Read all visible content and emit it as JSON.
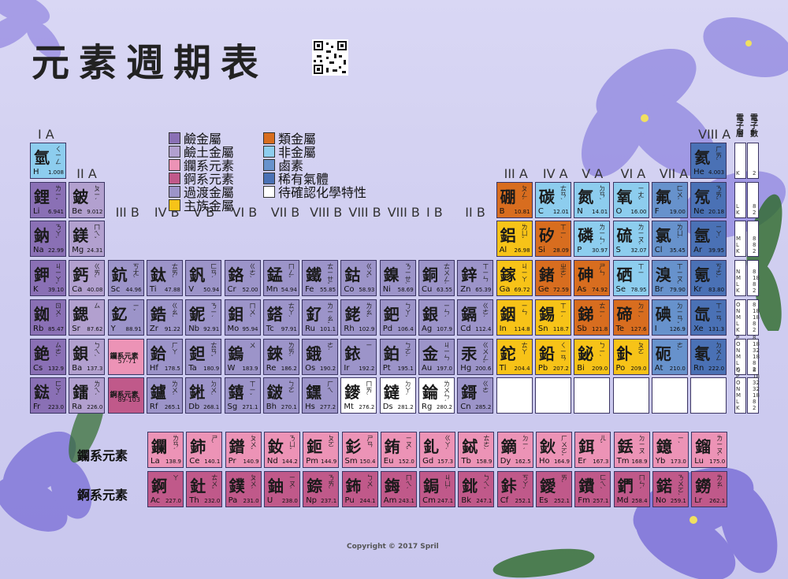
{
  "title": "元素週期表",
  "colors": {
    "alkali": "#8a70b5",
    "alkaline_earth": "#b2a0cf",
    "lanthanide": "#ec93b6",
    "actinide": "#c0598a",
    "transition": "#9c94c9",
    "main_metal": "#f7c318",
    "metalloid": "#d86d1f",
    "nonmetal": "#8dcdee",
    "halogen": "#6792cc",
    "noble_gas": "#4a71b5",
    "unknown": "#ffffff"
  },
  "legend": [
    {
      "label": "鹼金屬",
      "type": "alkali"
    },
    {
      "label": "鹼土金屬",
      "type": "alkaline_earth"
    },
    {
      "label": "鑭系元素",
      "type": "lanthanide"
    },
    {
      "label": "錒系元素",
      "type": "actinide"
    },
    {
      "label": "過渡金屬",
      "type": "transition"
    },
    {
      "label": "主族金屬",
      "type": "main_metal"
    },
    {
      "label": "類金屬",
      "type": "metalloid"
    },
    {
      "label": "非金屬",
      "type": "nonmetal"
    },
    {
      "label": "鹵素",
      "type": "halogen"
    },
    {
      "label": "稀有氣體",
      "type": "noble_gas"
    },
    {
      "label": "待確認化學特性",
      "type": "unknown"
    }
  ],
  "group_labels": [
    "I A",
    "II A",
    "III B",
    "IV B",
    "V B",
    "VI B",
    "VII B",
    "VIII B",
    "VIII B",
    "VIII B",
    "I B",
    "II B",
    "III A",
    "IV A",
    "V A",
    "VI A",
    "VII A",
    "VIII A"
  ],
  "shell_headers": {
    "shell": "電子層",
    "electrons": "電子數"
  },
  "shells": [
    {
      "k": "K",
      "e": "2"
    },
    {
      "k": "L K",
      "e": "8 2"
    },
    {
      "k": "M L K",
      "e": "8 8 2"
    },
    {
      "k": "N M L K",
      "e": "8 18 8 2"
    },
    {
      "k": "O N M L K",
      "e": "8 18 18 8 2"
    },
    {
      "k": "P O N M L K",
      "e": "8 18 32 18 8 2"
    },
    {
      "k": "Q P O N M L K",
      "e": "8 18 32 32 18 8 2"
    }
  ],
  "elements": [
    {
      "ch": "氫",
      "zy": "ㄑㄧㄥ",
      "sym": "H",
      "mass": "1.008",
      "r": 1,
      "c": 1,
      "t": "nonmetal"
    },
    {
      "ch": "氦",
      "zy": "ㄏㄞˋ",
      "sym": "He",
      "mass": "4.003",
      "r": 1,
      "c": 18,
      "t": "noble_gas"
    },
    {
      "ch": "鋰",
      "zy": "ㄌㄧˇ",
      "sym": "Li",
      "mass": "6.941",
      "r": 2,
      "c": 1,
      "t": "alkali"
    },
    {
      "ch": "鈹",
      "zy": "ㄆㄧˊ",
      "sym": "Be",
      "mass": "9.012",
      "r": 2,
      "c": 2,
      "t": "alkaline_earth"
    },
    {
      "ch": "硼",
      "zy": "ㄆㄥˊ",
      "sym": "B",
      "mass": "10.81",
      "r": 2,
      "c": 13,
      "t": "metalloid"
    },
    {
      "ch": "碳",
      "zy": "ㄊㄢˋ",
      "sym": "C",
      "mass": "12.01",
      "r": 2,
      "c": 14,
      "t": "nonmetal"
    },
    {
      "ch": "氮",
      "zy": "ㄉㄢˋ",
      "sym": "N",
      "mass": "14.01",
      "r": 2,
      "c": 15,
      "t": "nonmetal"
    },
    {
      "ch": "氧",
      "zy": "ㄧㄤˇ",
      "sym": "O",
      "mass": "16.00",
      "r": 2,
      "c": 16,
      "t": "nonmetal"
    },
    {
      "ch": "氟",
      "zy": "ㄈㄨˊ",
      "sym": "F",
      "mass": "19.00",
      "r": 2,
      "c": 17,
      "t": "halogen"
    },
    {
      "ch": "氖",
      "zy": "ㄋㄞˇ",
      "sym": "Ne",
      "mass": "20.18",
      "r": 2,
      "c": 18,
      "t": "noble_gas"
    },
    {
      "ch": "鈉",
      "zy": "ㄋㄚˋ",
      "sym": "Na",
      "mass": "22.99",
      "r": 3,
      "c": 1,
      "t": "alkali"
    },
    {
      "ch": "鎂",
      "zy": "ㄇㄟˇ",
      "sym": "Mg",
      "mass": "24.31",
      "r": 3,
      "c": 2,
      "t": "alkaline_earth"
    },
    {
      "ch": "鋁",
      "zy": "ㄌㄩˇ",
      "sym": "Al",
      "mass": "26.98",
      "r": 3,
      "c": 13,
      "t": "main_metal"
    },
    {
      "ch": "矽",
      "zy": "ㄒㄧˋ",
      "sym": "Si",
      "mass": "28.09",
      "r": 3,
      "c": 14,
      "t": "metalloid"
    },
    {
      "ch": "磷",
      "zy": "ㄌㄧㄣˊ",
      "sym": "P",
      "mass": "30.97",
      "r": 3,
      "c": 15,
      "t": "nonmetal"
    },
    {
      "ch": "硫",
      "zy": "ㄌㄧㄡˊ",
      "sym": "S",
      "mass": "32.07",
      "r": 3,
      "c": 16,
      "t": "nonmetal"
    },
    {
      "ch": "氯",
      "zy": "ㄌㄩˋ",
      "sym": "Cl",
      "mass": "35.45",
      "r": 3,
      "c": 17,
      "t": "halogen"
    },
    {
      "ch": "氬",
      "zy": "ㄧㄚˋ",
      "sym": "Ar",
      "mass": "39.95",
      "r": 3,
      "c": 18,
      "t": "noble_gas"
    },
    {
      "ch": "鉀",
      "zy": "ㄐㄧㄚˇ",
      "sym": "K",
      "mass": "39.10",
      "r": 4,
      "c": 1,
      "t": "alkali"
    },
    {
      "ch": "鈣",
      "zy": "ㄍㄞˋ",
      "sym": "Ca",
      "mass": "40.08",
      "r": 4,
      "c": 2,
      "t": "alkaline_earth"
    },
    {
      "ch": "鈧",
      "zy": "ㄎㄤˋ",
      "sym": "Sc",
      "mass": "44.96",
      "r": 4,
      "c": 3,
      "t": "transition"
    },
    {
      "ch": "鈦",
      "zy": "ㄊㄞˋ",
      "sym": "Ti",
      "mass": "47.88",
      "r": 4,
      "c": 4,
      "t": "transition"
    },
    {
      "ch": "釩",
      "zy": "ㄈㄢˊ",
      "sym": "V",
      "mass": "50.94",
      "r": 4,
      "c": 5,
      "t": "transition"
    },
    {
      "ch": "鉻",
      "zy": "ㄍㄜˋ",
      "sym": "Cr",
      "mass": "52.00",
      "r": 4,
      "c": 6,
      "t": "transition"
    },
    {
      "ch": "錳",
      "zy": "ㄇㄥˇ",
      "sym": "Mn",
      "mass": "54.94",
      "r": 4,
      "c": 7,
      "t": "transition"
    },
    {
      "ch": "鐵",
      "zy": "ㄊㄧㄝˇ",
      "sym": "Fe",
      "mass": "55.85",
      "r": 4,
      "c": 8,
      "t": "transition"
    },
    {
      "ch": "鈷",
      "zy": "ㄍㄨˇ",
      "sym": "Co",
      "mass": "58.93",
      "r": 4,
      "c": 9,
      "t": "transition"
    },
    {
      "ch": "鎳",
      "zy": "ㄋㄧㄝˋ",
      "sym": "Ni",
      "mass": "58.69",
      "r": 4,
      "c": 10,
      "t": "transition"
    },
    {
      "ch": "銅",
      "zy": "ㄊㄨㄥˊ",
      "sym": "Cu",
      "mass": "63.55",
      "r": 4,
      "c": 11,
      "t": "transition"
    },
    {
      "ch": "鋅",
      "zy": "ㄒㄧㄣ",
      "sym": "Zn",
      "mass": "65.39",
      "r": 4,
      "c": 12,
      "t": "transition"
    },
    {
      "ch": "鎵",
      "zy": "ㄐㄧㄚ",
      "sym": "Ga",
      "mass": "69.72",
      "r": 4,
      "c": 13,
      "t": "main_metal"
    },
    {
      "ch": "鍺",
      "zy": "ㄓㄜˇ",
      "sym": "Ge",
      "mass": "72.59",
      "r": 4,
      "c": 14,
      "t": "metalloid"
    },
    {
      "ch": "砷",
      "zy": "ㄕㄣ",
      "sym": "As",
      "mass": "74.92",
      "r": 4,
      "c": 15,
      "t": "metalloid"
    },
    {
      "ch": "硒",
      "zy": "ㄒㄧ",
      "sym": "Se",
      "mass": "78.95",
      "r": 4,
      "c": 16,
      "t": "nonmetal"
    },
    {
      "ch": "溴",
      "zy": "ㄒㄧㄡˋ",
      "sym": "Br",
      "mass": "79.90",
      "r": 4,
      "c": 17,
      "t": "halogen"
    },
    {
      "ch": "氪",
      "zy": "ㄎㄜˋ",
      "sym": "Kr",
      "mass": "83.80",
      "r": 4,
      "c": 18,
      "t": "noble_gas"
    },
    {
      "ch": "銣",
      "zy": "ㄖㄨˊ",
      "sym": "Rb",
      "mass": "85.47",
      "r": 5,
      "c": 1,
      "t": "alkali"
    },
    {
      "ch": "鍶",
      "zy": "ㄙ",
      "sym": "Sr",
      "mass": "87.62",
      "r": 5,
      "c": 2,
      "t": "alkaline_earth"
    },
    {
      "ch": "釔",
      "zy": "ㄧˇ",
      "sym": "Y",
      "mass": "88.91",
      "r": 5,
      "c": 3,
      "t": "transition"
    },
    {
      "ch": "鋯",
      "zy": "ㄍㄠˋ",
      "sym": "Zr",
      "mass": "91.22",
      "r": 5,
      "c": 4,
      "t": "transition"
    },
    {
      "ch": "鈮",
      "zy": "ㄋㄧˊ",
      "sym": "Nb",
      "mass": "92.91",
      "r": 5,
      "c": 5,
      "t": "transition"
    },
    {
      "ch": "鉬",
      "zy": "ㄇㄨˋ",
      "sym": "Mo",
      "mass": "95.94",
      "r": 5,
      "c": 6,
      "t": "transition"
    },
    {
      "ch": "鎝",
      "zy": "ㄊㄚˋ",
      "sym": "Tc",
      "mass": "97.91",
      "r": 5,
      "c": 7,
      "t": "transition"
    },
    {
      "ch": "釕",
      "zy": "ㄌㄧㄠˇ",
      "sym": "Ru",
      "mass": "101.1",
      "r": 5,
      "c": 8,
      "t": "transition"
    },
    {
      "ch": "銠",
      "zy": "ㄌㄠˇ",
      "sym": "Rh",
      "mass": "102.9",
      "r": 5,
      "c": 9,
      "t": "transition"
    },
    {
      "ch": "鈀",
      "zy": "ㄅㄚˇ",
      "sym": "Pd",
      "mass": "106.4",
      "r": 5,
      "c": 10,
      "t": "transition"
    },
    {
      "ch": "銀",
      "zy": "ㄧㄣˊ",
      "sym": "Ag",
      "mass": "107.9",
      "r": 5,
      "c": 11,
      "t": "transition"
    },
    {
      "ch": "鎘",
      "zy": "ㄍㄜˊ",
      "sym": "Cd",
      "mass": "112.4",
      "r": 5,
      "c": 12,
      "t": "transition"
    },
    {
      "ch": "銦",
      "zy": "ㄧㄣ",
      "sym": "In",
      "mass": "114.8",
      "r": 5,
      "c": 13,
      "t": "main_metal"
    },
    {
      "ch": "錫",
      "zy": "ㄒㄧˊ",
      "sym": "Sn",
      "mass": "118.7",
      "r": 5,
      "c": 14,
      "t": "main_metal"
    },
    {
      "ch": "銻",
      "zy": "ㄊㄧˊ",
      "sym": "Sb",
      "mass": "121.8",
      "r": 5,
      "c": 15,
      "t": "metalloid"
    },
    {
      "ch": "碲",
      "zy": "ㄉㄧˋ",
      "sym": "Te",
      "mass": "127.6",
      "r": 5,
      "c": 16,
      "t": "metalloid"
    },
    {
      "ch": "碘",
      "zy": "ㄉㄧㄢˇ",
      "sym": "I",
      "mass": "126.9",
      "r": 5,
      "c": 17,
      "t": "halogen"
    },
    {
      "ch": "氙",
      "zy": "ㄒㄧㄢ",
      "sym": "Xe",
      "mass": "131.3",
      "r": 5,
      "c": 18,
      "t": "noble_gas"
    },
    {
      "ch": "銫",
      "zy": "ㄙㄜˋ",
      "sym": "Cs",
      "mass": "132.9",
      "r": 6,
      "c": 1,
      "t": "alkali"
    },
    {
      "ch": "鋇",
      "zy": "ㄅㄟˋ",
      "sym": "Ba",
      "mass": "137.3",
      "r": 6,
      "c": 2,
      "t": "alkaline_earth"
    },
    {
      "ch": "鑭系元素",
      "zy": "",
      "sym": "57-71",
      "mass": "",
      "r": 6,
      "c": 3,
      "t": "lanthanide",
      "ph": true
    },
    {
      "ch": "鉿",
      "zy": "ㄏㄚ",
      "sym": "Hf",
      "mass": "178.5",
      "r": 6,
      "c": 4,
      "t": "transition"
    },
    {
      "ch": "鉭",
      "zy": "ㄊㄢˇ",
      "sym": "Ta",
      "mass": "180.9",
      "r": 6,
      "c": 5,
      "t": "transition"
    },
    {
      "ch": "鎢",
      "zy": "ㄨ",
      "sym": "W",
      "mass": "183.9",
      "r": 6,
      "c": 6,
      "t": "transition"
    },
    {
      "ch": "錸",
      "zy": "ㄌㄞˊ",
      "sym": "Re",
      "mass": "186.2",
      "r": 6,
      "c": 7,
      "t": "transition"
    },
    {
      "ch": "鋨",
      "zy": "ㄜˊ",
      "sym": "Os",
      "mass": "190.2",
      "r": 6,
      "c": 8,
      "t": "transition"
    },
    {
      "ch": "銥",
      "zy": "ㄧ",
      "sym": "Ir",
      "mass": "192.2",
      "r": 6,
      "c": 9,
      "t": "transition"
    },
    {
      "ch": "鉑",
      "zy": "ㄅㄛˊ",
      "sym": "Pt",
      "mass": "195.1",
      "r": 6,
      "c": 10,
      "t": "transition"
    },
    {
      "ch": "金",
      "zy": "ㄐㄧㄣ",
      "sym": "Au",
      "mass": "197.0",
      "r": 6,
      "c": 11,
      "t": "transition"
    },
    {
      "ch": "汞",
      "zy": "ㄍㄨㄥˇ",
      "sym": "Hg",
      "mass": "200.6",
      "r": 6,
      "c": 12,
      "t": "transition"
    },
    {
      "ch": "鉈",
      "zy": "ㄊㄚ",
      "sym": "Tl",
      "mass": "204.4",
      "r": 6,
      "c": 13,
      "t": "main_metal"
    },
    {
      "ch": "鉛",
      "zy": "ㄑㄧㄢ",
      "sym": "Pb",
      "mass": "207.2",
      "r": 6,
      "c": 14,
      "t": "main_metal"
    },
    {
      "ch": "鉍",
      "zy": "ㄅㄧˋ",
      "sym": "Bi",
      "mass": "209.0",
      "r": 6,
      "c": 15,
      "t": "main_metal"
    },
    {
      "ch": "釙",
      "zy": "ㄆㄛ",
      "sym": "Po",
      "mass": "209.0",
      "r": 6,
      "c": 16,
      "t": "main_metal"
    },
    {
      "ch": "砈",
      "zy": "ㄜˋ",
      "sym": "At",
      "mass": "210.0",
      "r": 6,
      "c": 17,
      "t": "halogen"
    },
    {
      "ch": "氡",
      "zy": "ㄉㄨㄥ",
      "sym": "Rn",
      "mass": "222.0",
      "r": 6,
      "c": 18,
      "t": "noble_gas"
    },
    {
      "ch": "鍅",
      "zy": "ㄈㄚˇ",
      "sym": "Fr",
      "mass": "223.0",
      "r": 7,
      "c": 1,
      "t": "alkali"
    },
    {
      "ch": "鐳",
      "zy": "ㄌㄟˊ",
      "sym": "Ra",
      "mass": "226.0",
      "r": 7,
      "c": 2,
      "t": "alkaline_earth"
    },
    {
      "ch": "錒系元素",
      "zy": "",
      "sym": "89-103",
      "mass": "",
      "r": 7,
      "c": 3,
      "t": "actinide",
      "ph": true
    },
    {
      "ch": "鑪",
      "zy": "ㄌㄨˊ",
      "sym": "Rf",
      "mass": "265.1",
      "r": 7,
      "c": 4,
      "t": "transition"
    },
    {
      "ch": "𨧀",
      "zy": "ㄉㄨˋ",
      "sym": "Db",
      "mass": "268.1",
      "r": 7,
      "c": 5,
      "t": "transition"
    },
    {
      "ch": "𨭎",
      "zy": "ㄒㄧˇ",
      "sym": "Sg",
      "mass": "271.1",
      "r": 7,
      "c": 6,
      "t": "transition"
    },
    {
      "ch": "𨨏",
      "zy": "ㄅㄛ",
      "sym": "Bh",
      "mass": "270.1",
      "r": 7,
      "c": 7,
      "t": "transition"
    },
    {
      "ch": "𨭆",
      "zy": "ㄏㄟ",
      "sym": "Hs",
      "mass": "277.2",
      "r": 7,
      "c": 8,
      "t": "transition"
    },
    {
      "ch": "䥑",
      "zy": "ㄇㄞˋ",
      "sym": "Mt",
      "mass": "276.2",
      "r": 7,
      "c": 9,
      "t": "unknown"
    },
    {
      "ch": "鐽",
      "zy": "ㄉㄚˊ",
      "sym": "Ds",
      "mass": "281.2",
      "r": 7,
      "c": 10,
      "t": "unknown"
    },
    {
      "ch": "錀",
      "zy": "ㄌㄨㄣˊ",
      "sym": "Rg",
      "mass": "280.2",
      "r": 7,
      "c": 11,
      "t": "unknown"
    },
    {
      "ch": "鎶",
      "zy": "ㄍㄜ",
      "sym": "Cn",
      "mass": "285.2",
      "r": 7,
      "c": 12,
      "t": "transition"
    },
    {
      "ch": "",
      "zy": "",
      "sym": "",
      "mass": "",
      "r": 7,
      "c": 13,
      "t": "unknown"
    },
    {
      "ch": "",
      "zy": "",
      "sym": "",
      "mass": "",
      "r": 7,
      "c": 14,
      "t": "unknown"
    },
    {
      "ch": "",
      "zy": "",
      "sym": "",
      "mass": "",
      "r": 7,
      "c": 15,
      "t": "unknown"
    },
    {
      "ch": "",
      "zy": "",
      "sym": "",
      "mass": "",
      "r": 7,
      "c": 16,
      "t": "unknown"
    },
    {
      "ch": "",
      "zy": "",
      "sym": "",
      "mass": "",
      "r": 7,
      "c": 17,
      "t": "unknown"
    },
    {
      "ch": "",
      "zy": "",
      "sym": "",
      "mass": "",
      "r": 7,
      "c": 18,
      "t": "unknown"
    }
  ],
  "series_labels": {
    "lanthanide": "鑭系元素",
    "actinide": "錒系元素"
  },
  "lanthanides": [
    {
      "ch": "鑭",
      "zy": "ㄌㄢˊ",
      "sym": "La",
      "mass": "138.9"
    },
    {
      "ch": "鈰",
      "zy": "ㄕˋ",
      "sym": "Ce",
      "mass": "140.1"
    },
    {
      "ch": "鐠",
      "zy": "ㄆㄨˇ",
      "sym": "Pr",
      "mass": "140.9"
    },
    {
      "ch": "釹",
      "zy": "ㄋㄩˇ",
      "sym": "Nd",
      "mass": "144.2"
    },
    {
      "ch": "鉕",
      "zy": "ㄆㄛ",
      "sym": "Pm",
      "mass": "144.9"
    },
    {
      "ch": "釤",
      "zy": "ㄕㄢ",
      "sym": "Sm",
      "mass": "150.4"
    },
    {
      "ch": "銪",
      "zy": "ㄧㄡˇ",
      "sym": "Eu",
      "mass": "152.0"
    },
    {
      "ch": "釓",
      "zy": "ㄍㄚˊ",
      "sym": "Gd",
      "mass": "157.3"
    },
    {
      "ch": "鋱",
      "zy": "ㄊㄜˋ",
      "sym": "Tb",
      "mass": "158.9"
    },
    {
      "ch": "鏑",
      "zy": "ㄉㄧˊ",
      "sym": "Dy",
      "mass": "162.5"
    },
    {
      "ch": "鈥",
      "zy": "ㄏㄨㄛˇ",
      "sym": "Ho",
      "mass": "164.9"
    },
    {
      "ch": "鉺",
      "zy": "ㄦˇ",
      "sym": "Er",
      "mass": "167.3"
    },
    {
      "ch": "銩",
      "zy": "ㄉㄧㄡ",
      "sym": "Tm",
      "mass": "168.9"
    },
    {
      "ch": "鐿",
      "zy": "ㄧˋ",
      "sym": "Yb",
      "mass": "173.0"
    },
    {
      "ch": "鎦",
      "zy": "ㄌㄧㄡˊ",
      "sym": "Lu",
      "mass": "175.0"
    }
  ],
  "actinides": [
    {
      "ch": "錒",
      "zy": "ㄚ",
      "sym": "Ac",
      "mass": "227.0"
    },
    {
      "ch": "釷",
      "zy": "ㄊㄨˇ",
      "sym": "Th",
      "mass": "232.0"
    },
    {
      "ch": "鏷",
      "zy": "ㄆㄨˊ",
      "sym": "Pa",
      "mass": "231.0"
    },
    {
      "ch": "鈾",
      "zy": "ㄧㄡˊ",
      "sym": "U",
      "mass": "238.0"
    },
    {
      "ch": "錼",
      "zy": "ㄋㄞˋ",
      "sym": "Np",
      "mass": "237.1"
    },
    {
      "ch": "鈽",
      "zy": "ㄅㄨˋ",
      "sym": "Pu",
      "mass": "244.1"
    },
    {
      "ch": "鋂",
      "zy": "ㄇㄟˊ",
      "sym": "Am",
      "mass": "243.1"
    },
    {
      "ch": "鋦",
      "zy": "ㄐㄩˊ",
      "sym": "Cm",
      "mass": "247.1"
    },
    {
      "ch": "鉳",
      "zy": "ㄅㄟˇ",
      "sym": "Bk",
      "mass": "247.1"
    },
    {
      "ch": "鉲",
      "zy": "ㄎㄚˇ",
      "sym": "Cf",
      "mass": "252.1"
    },
    {
      "ch": "鑀",
      "zy": "ㄞˋ",
      "sym": "Es",
      "mass": "252.1"
    },
    {
      "ch": "鐨",
      "zy": "ㄈㄟˋ",
      "sym": "Fm",
      "mass": "257.1"
    },
    {
      "ch": "鍆",
      "zy": "ㄇㄣˊ",
      "sym": "Md",
      "mass": "258.4"
    },
    {
      "ch": "鍩",
      "zy": "ㄋㄨㄛˋ",
      "sym": "No",
      "mass": "259.1"
    },
    {
      "ch": "鐒",
      "zy": "ㄌㄠˊ",
      "sym": "Lr",
      "mass": "262.1"
    }
  ],
  "copyright": "Copyright © 2017 Spril"
}
